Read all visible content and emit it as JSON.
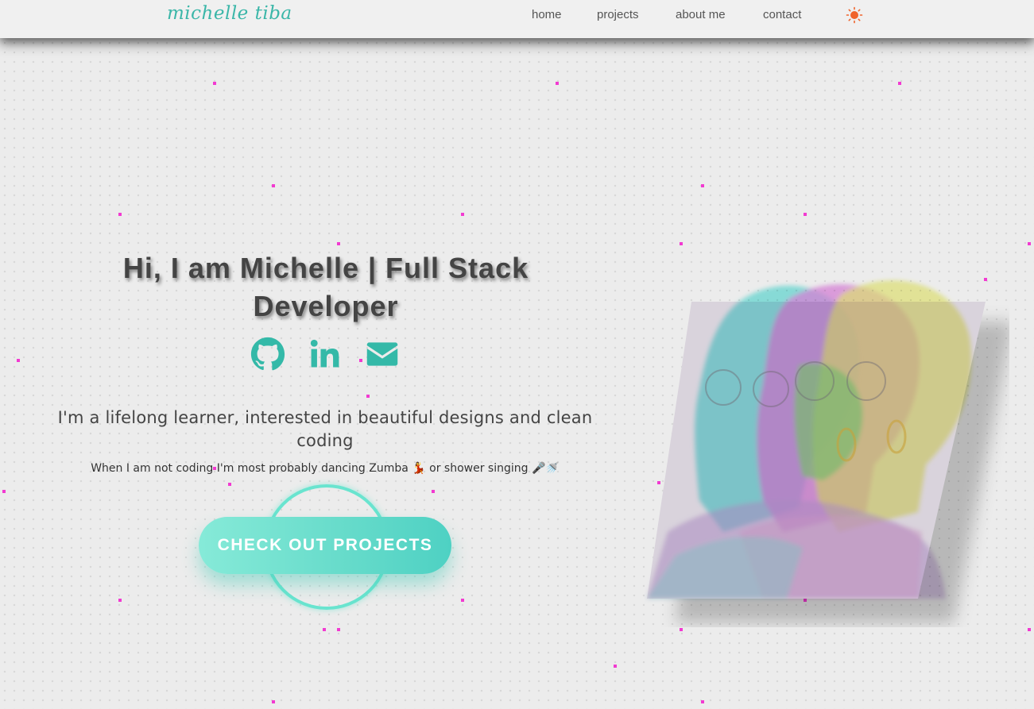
{
  "navbar": {
    "logo": "michelle tiba",
    "links": [
      {
        "label": "home"
      },
      {
        "label": "projects"
      },
      {
        "label": "about me"
      },
      {
        "label": "contact"
      }
    ],
    "theme_toggle_icon": "sun-icon",
    "theme_toggle_color": "#f0632b"
  },
  "hero": {
    "title": "Hi, I am Michelle | Full Stack Developer",
    "social_icons": [
      "github-icon",
      "linkedin-icon",
      "envelope-icon"
    ],
    "tagline": "I'm a lifelong learner, interested in beautiful designs and clean coding",
    "subtext": "When I am not coding I'm most probably dancing Zumba 💃 or shower singing 🎤🚿",
    "cta_label": "CHECK OUT PROJECTS",
    "portrait_icon": "portrait-illustration"
  },
  "colors": {
    "accent": "#3ab6a8",
    "cta_start": "#86ead8",
    "cta_end": "#4ed1c3",
    "dots": "#f23ad1",
    "background": "#ececec"
  }
}
